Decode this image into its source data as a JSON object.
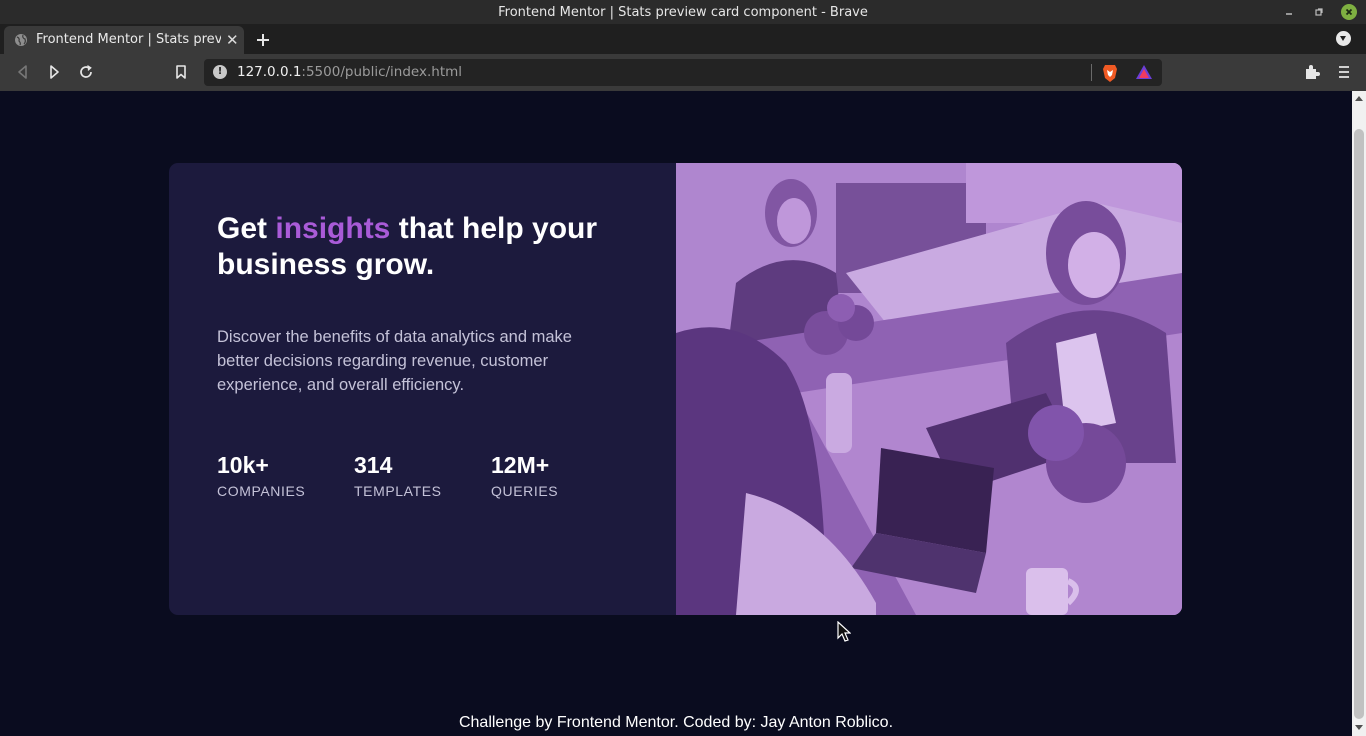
{
  "window": {
    "title": "Frontend Mentor | Stats preview card component - Brave"
  },
  "tabs": [
    {
      "label": "Frontend Mentor | Stats preview card component",
      "icon": "globe-icon"
    }
  ],
  "toolbar": {
    "url_host": "127.0.0.1",
    "url_path": ":5500/public/index.html"
  },
  "card": {
    "headline_before": "Get ",
    "headline_accent": "insights",
    "headline_after": " that help your business grow.",
    "description": "Discover the benefits of data analytics and make better decisions regarding revenue, customer experience, and overall efficiency.",
    "stats": [
      {
        "value": "10k+",
        "label": "COMPANIES"
      },
      {
        "value": "314",
        "label": "TEMPLATES"
      },
      {
        "value": "12M+",
        "label": "QUERIES"
      }
    ]
  },
  "footer": {
    "text": "Challenge by Frontend Mentor. Coded by: Jay Anton Roblico."
  },
  "colors": {
    "page_bg": "#0a0c1f",
    "card_bg": "#1c1a3d",
    "accent": "#a95bd8",
    "image_tint": "#a57cc2"
  }
}
